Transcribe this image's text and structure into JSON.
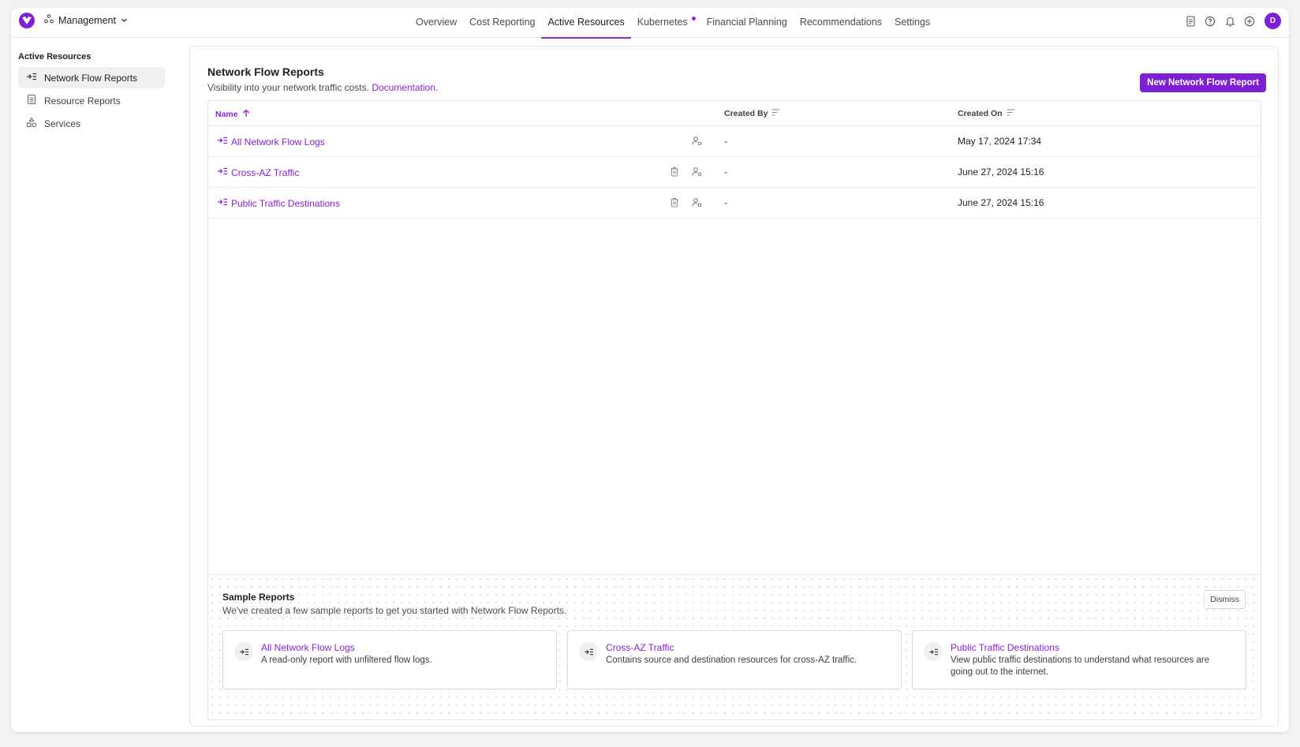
{
  "nav": {
    "workspace": "Management",
    "tabs": [
      "Overview",
      "Cost Reporting",
      "Active Resources",
      "Kubernetes",
      "Financial Planning",
      "Recommendations",
      "Settings"
    ],
    "active_tab": "Active Resources",
    "avatar_initial": "D"
  },
  "sidebar": {
    "title": "Active Resources",
    "items": [
      {
        "label": "Network Flow Reports",
        "icon": "flow-report-icon",
        "active": true
      },
      {
        "label": "Resource Reports",
        "icon": "document-icon",
        "active": false
      },
      {
        "label": "Services",
        "icon": "shapes-icon",
        "active": false
      }
    ]
  },
  "page": {
    "title": "Network Flow Reports",
    "subtitle": "Visibility into your network traffic costs.",
    "doc_link": "Documentation",
    "doc_suffix": ".",
    "new_button": "New Network Flow Report"
  },
  "table": {
    "headers": {
      "name": "Name",
      "created_by": "Created By",
      "created_on": "Created On"
    },
    "rows": [
      {
        "name": "All Network Flow Logs",
        "created_by": "-",
        "created_on": "May 17, 2024 17:34"
      },
      {
        "name": "Cross-AZ Traffic",
        "created_by": "-",
        "created_on": "June 27, 2024 15:16"
      },
      {
        "name": "Public Traffic Destinations",
        "created_by": "-",
        "created_on": "June 27, 2024 15:16"
      }
    ]
  },
  "samples": {
    "title": "Sample Reports",
    "subtitle": "We've created a few sample reports to get you started with Network Flow Reports.",
    "dismiss": "Dismiss",
    "cards": [
      {
        "title": "All Network Flow Logs",
        "desc": "A read-only report with unfiltered flow logs."
      },
      {
        "title": "Cross-AZ Traffic",
        "desc": "Contains source and destination resources for cross-AZ traffic."
      },
      {
        "title": "Public Traffic Destinations",
        "desc": "View public traffic destinations to understand what resources are going out to the internet."
      }
    ]
  },
  "colors": {
    "accent": "#7c1fd6",
    "link": "#8a1fd6"
  }
}
